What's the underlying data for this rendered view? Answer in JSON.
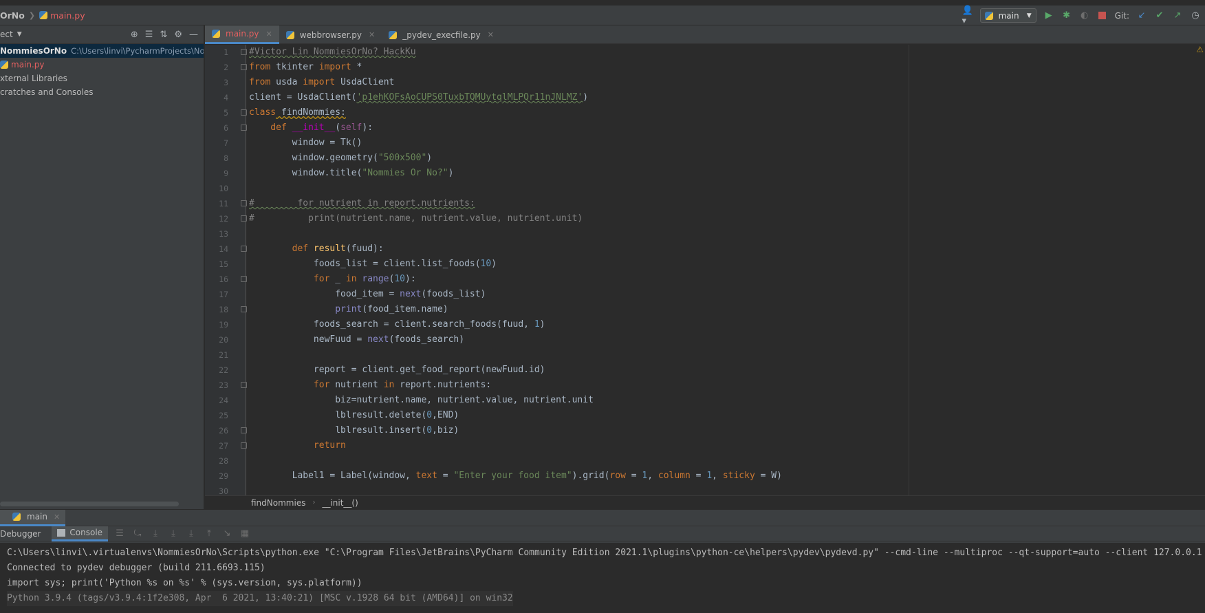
{
  "navbar": {
    "project": "OrNo",
    "file": "main.py",
    "run_config": "main",
    "git_label": "Git:"
  },
  "project_panel": {
    "title": "ect",
    "items": [
      {
        "label": "NommiesOrNo",
        "path": "C:\\Users\\linvi\\PycharmProjects\\NommiesOrNo"
      },
      {
        "label": "main.py"
      },
      {
        "label": "xternal Libraries"
      },
      {
        "label": "cratches and Consoles"
      }
    ]
  },
  "editor_tabs": [
    {
      "label": "main.py"
    },
    {
      "label": "webbrowser.py"
    },
    {
      "label": "_pydev_execfile.py"
    }
  ],
  "code_lines": [
    "1",
    "2",
    "3",
    "4",
    "5",
    "6",
    "7",
    "8",
    "9",
    "10",
    "11",
    "12",
    "13",
    "14",
    "15",
    "16",
    "17",
    "18",
    "19",
    "20",
    "21",
    "22",
    "23",
    "24",
    "25",
    "26",
    "27",
    "28",
    "29",
    "30"
  ],
  "code": {
    "l1": "#Victor Lin NommiesOrNo? HackKu",
    "l2a": "from",
    "l2b": " tkinter ",
    "l2c": "import",
    "l2d": " *",
    "l3a": "from",
    "l3b": " usda ",
    "l3c": "import",
    "l3d": " UsdaClient",
    "l4a": "client = UsdaClient(",
    "l4b": "'p1ehKOFsAoCUPS0TuxbTQMUytqlMLPQr11nJNLMZ'",
    "l4c": ")",
    "l5a": "class",
    "l5b": " findNommies:",
    "l6a": "    def ",
    "l6b": "__init__",
    "l6c": "(",
    "l6d": "self",
    "l6e": "):",
    "l7": "        window = Tk()",
    "l8a": "        window.geometry(",
    "l8b": "\"500x500\"",
    "l8c": ")",
    "l9a": "        window.title(",
    "l9b": "\"Nommies Or No?\"",
    "l9c": ")",
    "l11": "#        for nutrient in report.nutrients:",
    "l12": "#          print(nutrient.name, nutrient.value, nutrient.unit)",
    "l14a": "        def ",
    "l14b": "result",
    "l14c": "(fuud):",
    "l15a": "            foods_list = client.list_foods(",
    "l15b": "10",
    "l15c": ")",
    "l16a": "            for",
    "l16b": " _ ",
    "l16c": "in",
    "l16d": " range",
    "l16e": "(",
    "l16f": "10",
    "l16g": "):",
    "l17a": "                food_item = ",
    "l17b": "next",
    "l17c": "(foods_list)",
    "l18a": "                ",
    "l18b": "print",
    "l18c": "(food_item.name)",
    "l19a": "            foods_search = client.search_foods(fuud, ",
    "l19b": "1",
    "l19c": ")",
    "l20a": "            newFuud = ",
    "l20b": "next",
    "l20c": "(foods_search)",
    "l22": "            report = client.get_food_report(newFuud.id)",
    "l23a": "            for",
    "l23b": " nutrient ",
    "l23c": "in",
    "l23d": " report.nutrients:",
    "l24": "                biz=nutrient.name, nutrient.value, nutrient.unit",
    "l25a": "                lblresult.delete(",
    "l25b": "0",
    "l25c": ",END)",
    "l26a": "                lblresult.insert(",
    "l26b": "0",
    "l26c": ",biz)",
    "l27": "            return",
    "l29a": "        Label1 = Label(window, ",
    "l29b": "text",
    "l29c": " = ",
    "l29d": "\"Enter your food item\"",
    "l29e": ").grid(",
    "l29f": "row",
    "l29g": " = ",
    "l29h": "1",
    "l29i": ", ",
    "l29j": "column",
    "l29k": " = ",
    "l29l": "1",
    "l29m": ", ",
    "l29n": "sticky",
    "l29o": " = W)"
  },
  "editor_crumbs": [
    "findNommies",
    "__init__()"
  ],
  "debug": {
    "tab": "main",
    "subtab_debugger": "Debugger",
    "subtab_console": "Console",
    "console": [
      "C:\\Users\\linvi\\.virtualenvs\\NommiesOrNo\\Scripts\\python.exe \"C:\\Program Files\\JetBrains\\PyCharm Community Edition 2021.1\\plugins\\python-ce\\helpers\\pydev\\pydevd.py\" --cmd-line --multiproc --qt-support=auto --client 127.0.0.1",
      "Connected to pydev debugger (build 211.6693.115)",
      "import sys; print('Python %s on %s' % (sys.version, sys.platform))",
      "Python 3.9.4 (tags/v3.9.4:1f2e308, Apr  6 2021, 13:40:21) [MSC v.1928 64 bit (AMD64)] on win32"
    ]
  },
  "colors": {
    "accent": "#4a88c7",
    "keyword": "#cc7832",
    "string": "#6a8759",
    "number": "#6897bb",
    "function": "#ffc66d",
    "comment": "#808080"
  }
}
